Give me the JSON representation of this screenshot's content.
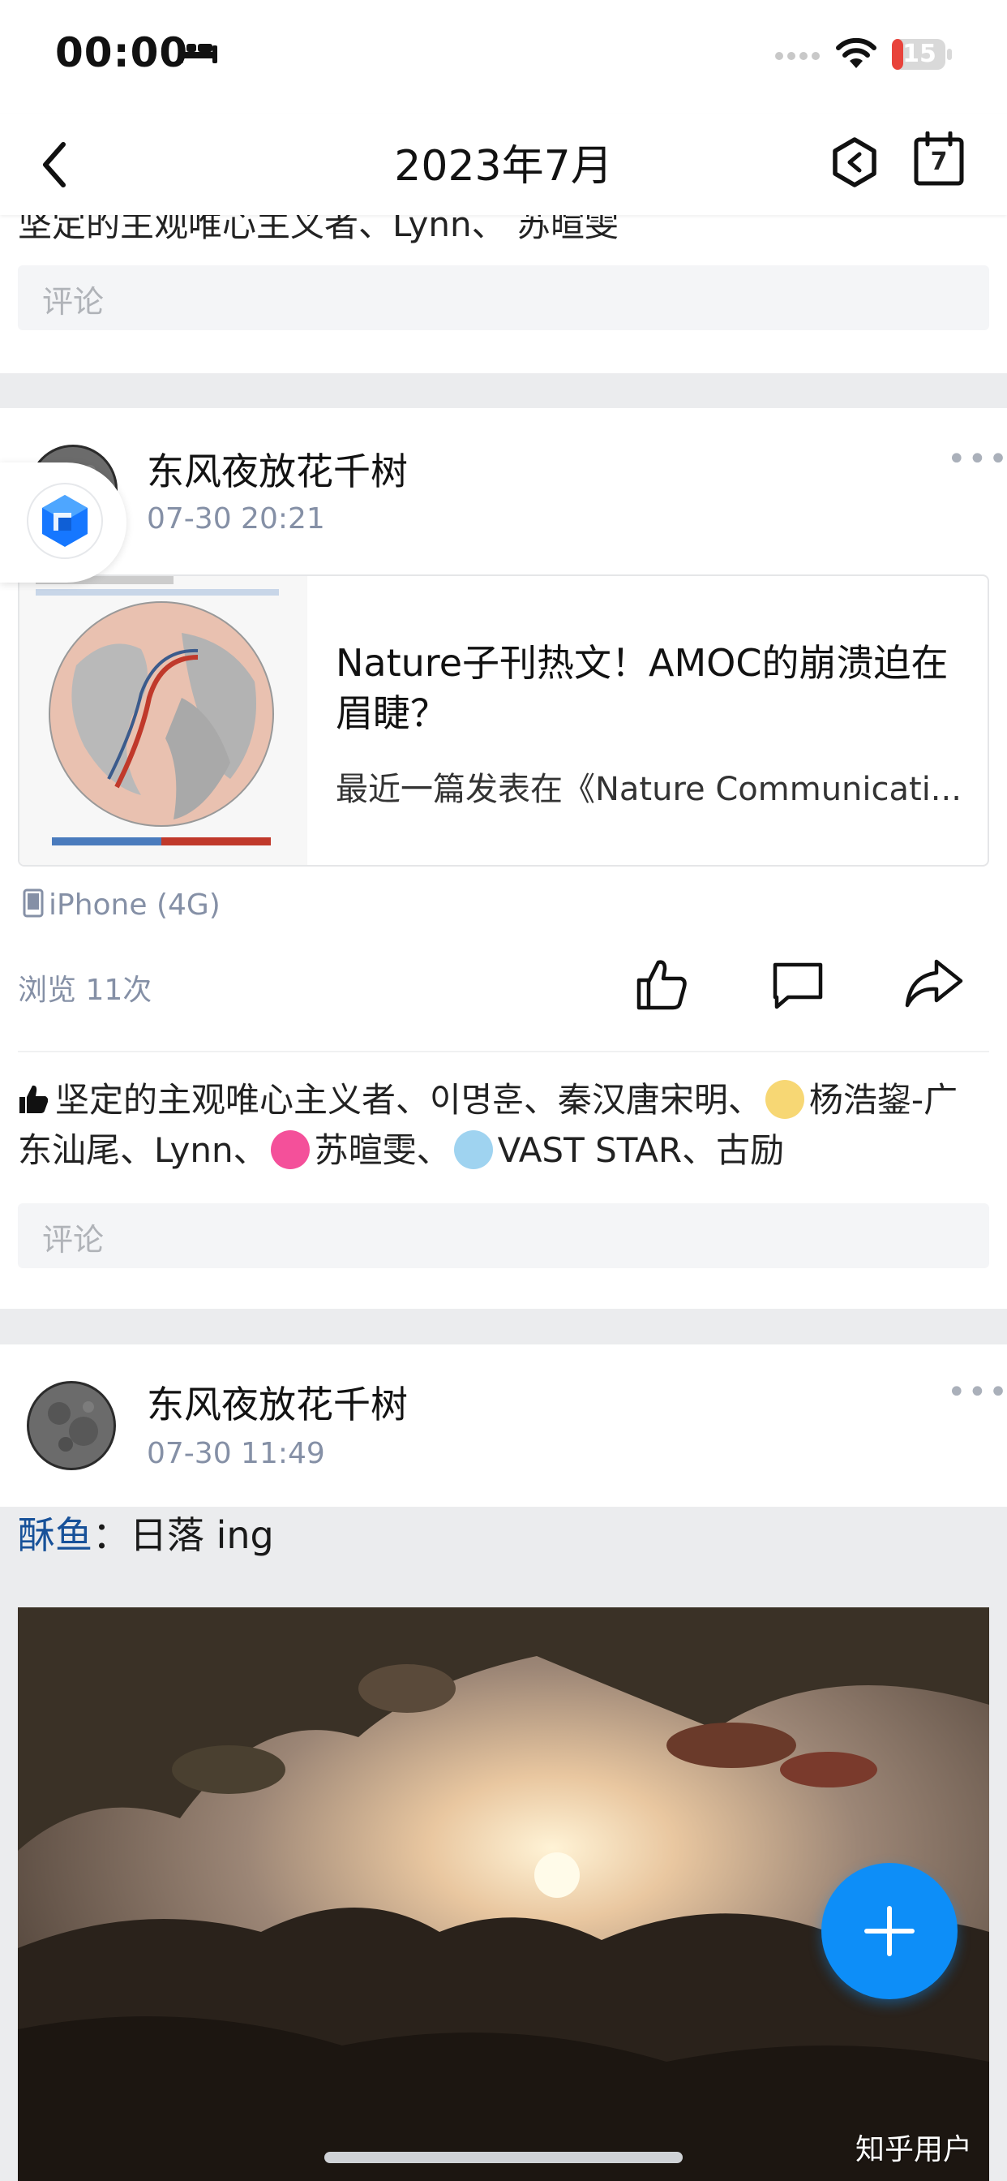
{
  "status_bar": {
    "time": "00:00",
    "battery": "15"
  },
  "nav": {
    "title": "2023年7月",
    "calendar_day": "7"
  },
  "top_card": {
    "likers_partial": "坚定的主观唯心主义者、Lynn、 苏暄雯",
    "comment_placeholder": "评论"
  },
  "post1": {
    "author": "东风夜放花千树",
    "time": "07-30 20:21",
    "link": {
      "title": "Nature子刊热文！AMOC的崩溃迫在眉睫？",
      "summary": "最近一篇发表在《Nature Communicati..."
    },
    "device": "iPhone (4G)",
    "views": "浏览 11次",
    "likers": {
      "part1": "坚定的主观唯心主义者、이명훈、秦汉唐宋明、",
      "part2": "杨浩鋆-广东汕尾、Lynn、",
      "part3": "苏暄雯、",
      "part4": "VAST STAR、古励"
    },
    "comment_placeholder": "评论"
  },
  "post2": {
    "author": "东风夜放花千树",
    "time": "07-30 11:49",
    "pin_author": "酥鱼",
    "pin_text": "：日落 ing"
  },
  "watermark": "知乎用户",
  "colors": {
    "accent": "#0d8ef8",
    "link_blue": "#175199",
    "muted": "#8590a6"
  }
}
